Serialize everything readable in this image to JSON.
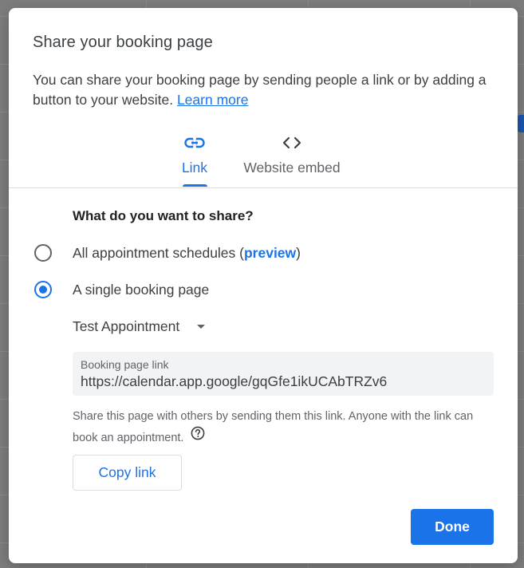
{
  "dialog": {
    "title": "Share your booking page",
    "description": "You can share your booking page by sending people a link or by adding a button to your website.",
    "learn_more_label": "Learn more"
  },
  "tabs": [
    {
      "label": "Link",
      "icon": "link-icon",
      "selected": true
    },
    {
      "label": "Website embed",
      "icon": "code-icon",
      "selected": false
    }
  ],
  "share_options": {
    "question": "What do you want to share?",
    "all_schedules_label": "All appointment schedules (",
    "all_schedules_preview": "preview",
    "all_schedules_suffix": ")",
    "single_page_label": "A single booking page",
    "selected": "single_page"
  },
  "appointment_select": {
    "value": "Test Appointment"
  },
  "booking_link": {
    "caption": "Booking page link",
    "url": "https://calendar.app.google/gqGfe1ikUCAbTRZv6"
  },
  "helper_text": "Share this page with others by sending them this link. Anyone with the link can book an appointment.",
  "buttons": {
    "copy_link": "Copy link",
    "done": "Done"
  },
  "colors": {
    "accent": "#1a73e8",
    "text_primary": "#3c4043",
    "text_secondary": "#5f6368"
  }
}
